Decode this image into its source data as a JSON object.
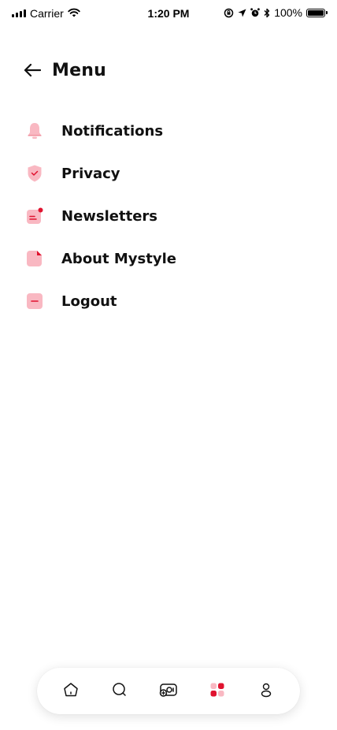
{
  "status_bar": {
    "carrier": "Carrier",
    "time": "1:20 PM",
    "battery": "100%",
    "icons": [
      "signal-icon",
      "wifi-icon",
      "screen-rotation-lock-icon",
      "location-arrow-icon",
      "alarm-icon",
      "bluetooth-icon",
      "battery-icon"
    ]
  },
  "header": {
    "back_icon": "arrow-left-icon",
    "title": "Menu"
  },
  "menu": {
    "items": [
      {
        "label": "Notifications",
        "icon": "bell-icon"
      },
      {
        "label": "Privacy",
        "icon": "shield-check-icon"
      },
      {
        "label": "Newsletters",
        "icon": "newsletter-icon"
      },
      {
        "label": "About Mystyle",
        "icon": "document-icon"
      },
      {
        "label": "Logout",
        "icon": "logout-icon"
      }
    ]
  },
  "tab_bar": {
    "tabs": [
      {
        "name": "home",
        "icon": "home-icon",
        "active": false
      },
      {
        "name": "search",
        "icon": "search-icon",
        "active": false
      },
      {
        "name": "add-photo",
        "icon": "add-photo-icon",
        "active": false
      },
      {
        "name": "menu",
        "icon": "grid-icon",
        "active": true
      },
      {
        "name": "profile",
        "icon": "user-icon",
        "active": false
      }
    ]
  },
  "colors": {
    "accent": "#e0132f",
    "accent_light": "#f9b8c2",
    "icon_bg": "#fbc9d1",
    "text": "#111111"
  }
}
